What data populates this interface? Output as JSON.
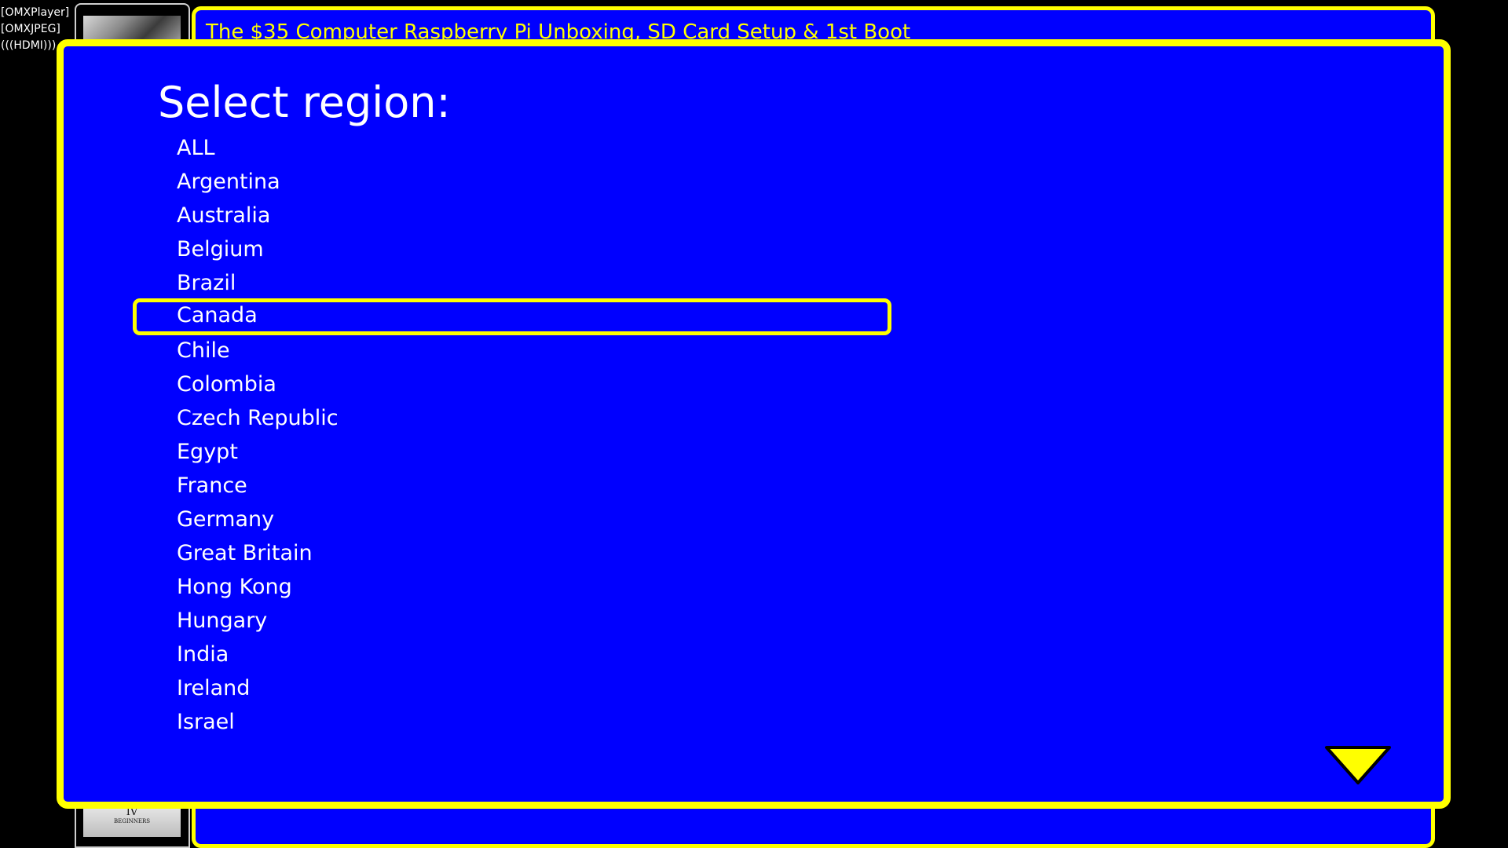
{
  "status": {
    "player": "[OMXPlayer]",
    "jpeg": "[OMXJPEG]",
    "output": "(((HDMI)))"
  },
  "background": {
    "video_title": "The $35 Computer Raspberry Pi Unboxing, SD Card Setup & 1st Boot",
    "thumbnail_text_roman": "IV",
    "thumbnail_text_small": "BEGINNERS"
  },
  "dialog": {
    "title": "Select region:",
    "selected": "Canada",
    "regions": [
      "ALL",
      "Argentina",
      "Australia",
      "Belgium",
      "Brazil",
      "Canada",
      "Chile",
      "Colombia",
      "Czech Republic",
      "Egypt",
      "France",
      "Germany",
      "Great Britain",
      "Hong Kong",
      "Hungary",
      "India",
      "Ireland",
      "Israel"
    ]
  },
  "icons": {
    "scroll_down": "triangle-down-icon"
  },
  "colors": {
    "background": "#000000",
    "panel": "#0000ff",
    "accent": "#ffff00",
    "text": "#ffffff"
  }
}
